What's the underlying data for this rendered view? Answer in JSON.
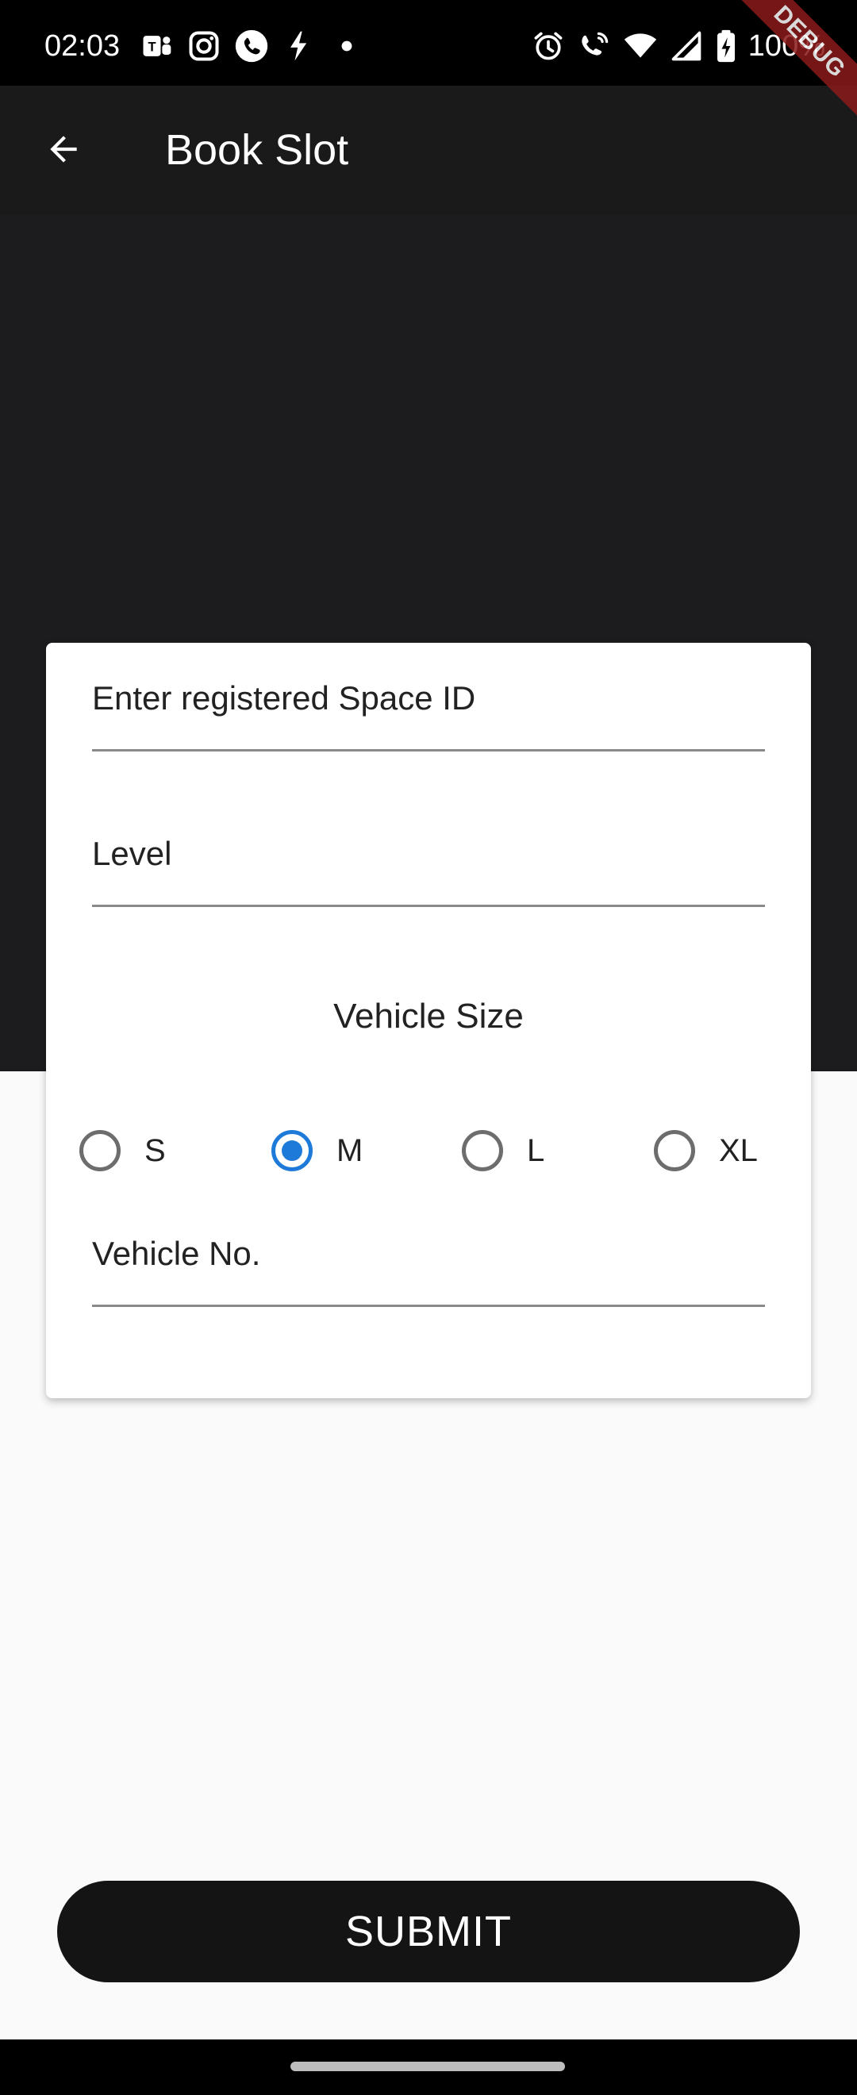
{
  "status_bar": {
    "time": "02:03",
    "left_icons": [
      "teams-icon",
      "instagram-icon",
      "phone-call-icon",
      "notification-icon",
      "dot-icon"
    ],
    "right_icons": [
      "alarm-icon",
      "wifi-calling-icon",
      "wifi-icon",
      "signal-icon",
      "battery-charging-icon"
    ],
    "battery_text": "100%"
  },
  "debug_banner": "DEBUG",
  "app_bar": {
    "title": "Book Slot",
    "back_icon": "arrow-back-icon"
  },
  "form": {
    "space_id": {
      "label": "Enter registered Space ID",
      "value": ""
    },
    "level": {
      "label": "Level",
      "value": ""
    },
    "vehicle_size": {
      "label": "Vehicle Size",
      "options": [
        "S",
        "M",
        "L",
        "XL"
      ],
      "selected": "M"
    },
    "vehicle_no": {
      "label": "Vehicle No.",
      "value": ""
    }
  },
  "submit": {
    "label": "SUBMIT"
  },
  "colors": {
    "accent": "#1e7ad8",
    "app_bar": "#1a1a1b",
    "hero": "#1c1c1e",
    "background": "#fafafa",
    "button": "#141414"
  }
}
